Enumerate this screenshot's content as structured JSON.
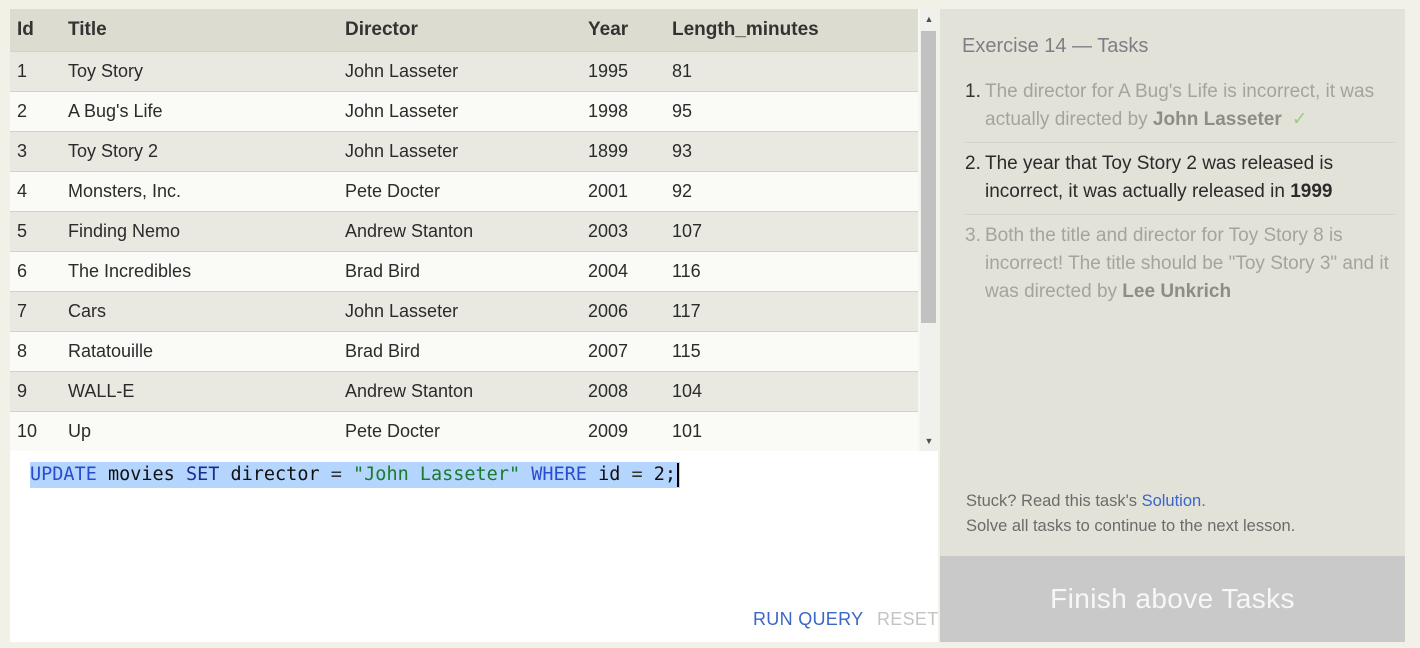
{
  "table": {
    "headers": [
      "Id",
      "Title",
      "Director",
      "Year",
      "Length_minutes"
    ],
    "rows": [
      [
        "1",
        "Toy Story",
        "John Lasseter",
        "1995",
        "81"
      ],
      [
        "2",
        "A Bug's Life",
        "John Lasseter",
        "1998",
        "95"
      ],
      [
        "3",
        "Toy Story 2",
        "John Lasseter",
        "1899",
        "93"
      ],
      [
        "4",
        "Monsters, Inc.",
        "Pete Docter",
        "2001",
        "92"
      ],
      [
        "5",
        "Finding Nemo",
        "Andrew Stanton",
        "2003",
        "107"
      ],
      [
        "6",
        "The Incredibles",
        "Brad Bird",
        "2004",
        "116"
      ],
      [
        "7",
        "Cars",
        "John Lasseter",
        "2006",
        "117"
      ],
      [
        "8",
        "Ratatouille",
        "Brad Bird",
        "2007",
        "115"
      ],
      [
        "9",
        "WALL-E",
        "Andrew Stanton",
        "2008",
        "104"
      ],
      [
        "10",
        "Up",
        "Pete Docter",
        "2009",
        "101"
      ]
    ]
  },
  "scrollbar": {
    "up_icon": "triangle-up-icon",
    "down_icon": "triangle-down-icon"
  },
  "editor": {
    "tokens": {
      "update": "UPDATE",
      "table": " movies ",
      "set": "SET",
      "col": " director ",
      "eq1": "=",
      "sp1": " ",
      "str": "\"John Lasseter\"",
      "sp2": " ",
      "where": "WHERE",
      "col2": " id ",
      "eq2": "=",
      "tail": " 2;"
    },
    "run_label": "RUN QUERY",
    "reset_label": "RESET"
  },
  "tasks": {
    "title": "Exercise 14 — Tasks",
    "items": [
      {
        "number": "1.",
        "text": "The director for A Bug's Life is incorrect, it was actually directed by ",
        "bold": "John Lasseter",
        "check": "✓",
        "status": "done"
      },
      {
        "number": "2.",
        "text": "The year that Toy Story 2 was released is incorrect, it was actually released in ",
        "bold": "1999",
        "status": "active"
      },
      {
        "number": "3.",
        "text": "Both the title and director for Toy Story 8 is incorrect! The title should be \"Toy Story 3\" and it was directed by ",
        "bold": "Lee Unkrich",
        "status": "pending"
      }
    ],
    "stuck_prefix": "Stuck? Read this task's ",
    "solution_link": "Solution",
    "stuck_suffix": ".",
    "continue_text": "Solve all tasks to continue to the next lesson."
  },
  "finish_button": {
    "label": "Finish above Tasks"
  },
  "colors": {
    "accent_link": "#3a66c7",
    "check_green": "#9ecc86",
    "finish_disabled": "#c9c9c9"
  }
}
